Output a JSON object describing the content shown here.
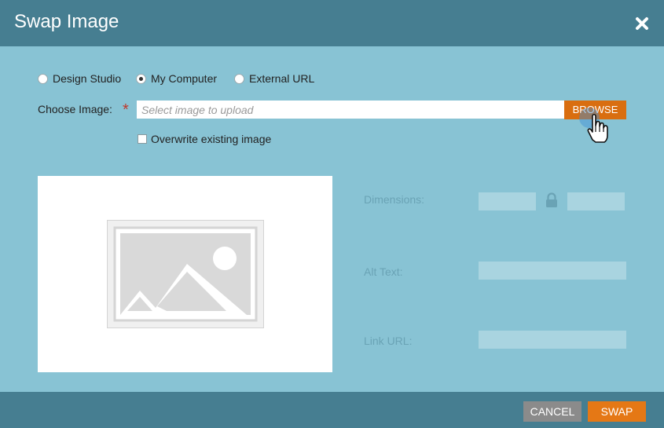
{
  "dialog": {
    "title": "Swap Image",
    "close_icon": "close-icon"
  },
  "source_options": [
    {
      "label": "Design Studio",
      "selected": false
    },
    {
      "label": "My Computer",
      "selected": true
    },
    {
      "label": "External URL",
      "selected": false
    }
  ],
  "choose_image": {
    "label": "Choose Image:",
    "required_mark": "*",
    "placeholder": "Select image to upload",
    "value": "",
    "browse_label": "BROWSE"
  },
  "overwrite": {
    "label": "Overwrite existing image",
    "checked": false
  },
  "preview": {
    "icon": "image-placeholder-icon"
  },
  "properties": {
    "dimensions_label": "Dimensions:",
    "width_value": "",
    "height_value": "",
    "lock_icon": "lock-icon",
    "alt_text_label": "Alt Text:",
    "alt_text_value": "",
    "link_url_label": "Link URL:",
    "link_url_value": ""
  },
  "footer": {
    "cancel_label": "CANCEL",
    "swap_label": "SWAP"
  },
  "colors": {
    "header": "#467e91",
    "body": "#88c3d4",
    "browse": "#d96e10",
    "swap": "#e57815",
    "cancel": "#8b8b8b"
  }
}
